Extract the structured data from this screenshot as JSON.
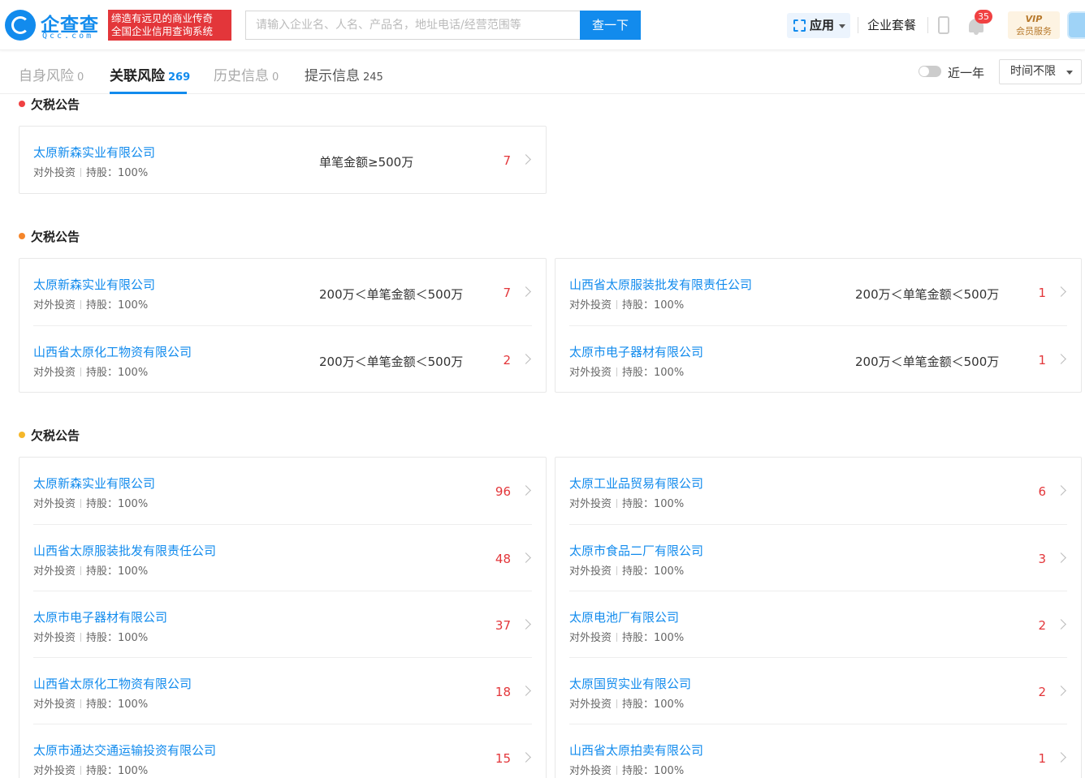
{
  "header": {
    "logo_name": "企查查",
    "logo_domain": "Qcc.com",
    "slogan_line1": "缔造有远见的商业传奇",
    "slogan_line2": "全国企业信用查询系统",
    "search_placeholder": "请输入企业名、人名、产品名，地址电话/经营范围等",
    "search_button": "查一下",
    "app_label": "应用",
    "package_link": "企业套餐",
    "notification_count": "35",
    "vip_top": "VIP",
    "vip_sub": "会员服务"
  },
  "tabs": [
    {
      "label": "自身风险",
      "count": "0"
    },
    {
      "label": "关联风险",
      "count": "269"
    },
    {
      "label": "历史信息",
      "count": "0"
    },
    {
      "label": "提示信息",
      "count": "245"
    }
  ],
  "filter": {
    "toggle_label": "近一年",
    "time_select": "时间不限"
  },
  "meta": {
    "type": "对外投资",
    "holding": "持股：100%"
  },
  "sections": [
    {
      "title": "欠税公告",
      "dot_color": "#f04142",
      "cards": [
        [
          {
            "company": "太原新森实业有限公司",
            "amount": "单笔金额≥500万",
            "count": "7"
          }
        ]
      ]
    },
    {
      "title": "欠税公告",
      "dot_color": "#f5862b",
      "cards": [
        [
          {
            "company": "太原新森实业有限公司",
            "amount": "200万＜单笔金额＜500万",
            "count": "7"
          },
          {
            "company": "山西省太原化工物资有限公司",
            "amount": "200万＜单笔金额＜500万",
            "count": "2"
          }
        ],
        [
          {
            "company": "山西省太原服装批发有限责任公司",
            "amount": "200万＜单笔金额＜500万",
            "count": "1"
          },
          {
            "company": "太原市电子器材有限公司",
            "amount": "200万＜单笔金额＜500万",
            "count": "1"
          }
        ]
      ]
    },
    {
      "title": "欠税公告",
      "dot_color": "#f5b72b",
      "cards": [
        [
          {
            "company": "太原新森实业有限公司",
            "amount": "",
            "count": "96"
          },
          {
            "company": "山西省太原服装批发有限责任公司",
            "amount": "",
            "count": "48"
          },
          {
            "company": "太原市电子器材有限公司",
            "amount": "",
            "count": "37"
          },
          {
            "company": "山西省太原化工物资有限公司",
            "amount": "",
            "count": "18"
          },
          {
            "company": "太原市通达交通运输投资有限公司",
            "amount": "",
            "count": "15"
          }
        ],
        [
          {
            "company": "太原工业品贸易有限公司",
            "amount": "",
            "count": "6"
          },
          {
            "company": "太原市食品二厂有限公司",
            "amount": "",
            "count": "3"
          },
          {
            "company": "太原电池厂有限公司",
            "amount": "",
            "count": "2"
          },
          {
            "company": "太原国贸实业有限公司",
            "amount": "",
            "count": "2"
          },
          {
            "company": "山西省太原拍卖有限公司",
            "amount": "",
            "count": "1"
          }
        ]
      ]
    }
  ]
}
